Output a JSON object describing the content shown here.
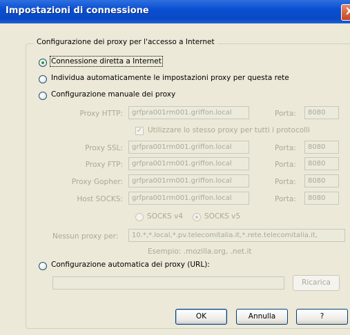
{
  "window": {
    "title": "Impostazioni di connessione",
    "close_symbol": "X"
  },
  "group": {
    "legend": "Configurazione dei proxy per l'accesso a Internet"
  },
  "options": {
    "direct": "Connessione diretta a Internet",
    "auto_detect": "Individua automaticamente le impostazioni proxy per questa rete",
    "manual": "Configurazione manuale dei proxy",
    "pac": "Configurazione automatica dei proxy (URL):"
  },
  "manual": {
    "http_label": "Proxy HTTP:",
    "http_value": "grfpra001rm001.griffon.local",
    "http_port_label": "Porta:",
    "http_port": "8080",
    "same_proxy_label": "Utilizzare lo stesso proxy per tutti i protocolli",
    "ssl_label": "Proxy SSL:",
    "ssl_value": "grfpra001rm001.griffon.local",
    "ssl_port_label": "Porta:",
    "ssl_port": "8080",
    "ftp_label": "Proxy FTP:",
    "ftp_value": "grfpra001rm001.griffon.local",
    "ftp_port_label": "Porta:",
    "ftp_port": "8080",
    "gopher_label": "Proxy Gopher:",
    "gopher_value": "grfpra001rm001.griffon.local",
    "gopher_port_label": "Porta:",
    "gopher_port": "8080",
    "socks_label": "Host SOCKS:",
    "socks_value": "grfpra001rm001.griffon.local",
    "socks_port_label": "Porta:",
    "socks_port": "8080",
    "socks_v4": "SOCKS v4",
    "socks_v5": "SOCKS v5",
    "no_proxy_label": "Nessun proxy per:",
    "no_proxy_value": "10.*,*.local,*.pv.telecomitalia.it,*.rete.telecomitalia.it,",
    "example": "Esempio: .mozilla.org, .net.it"
  },
  "pac": {
    "url_value": "",
    "reload_label": "Ricarica"
  },
  "buttons": {
    "ok": "OK",
    "cancel": "Annulla",
    "help": "?"
  }
}
